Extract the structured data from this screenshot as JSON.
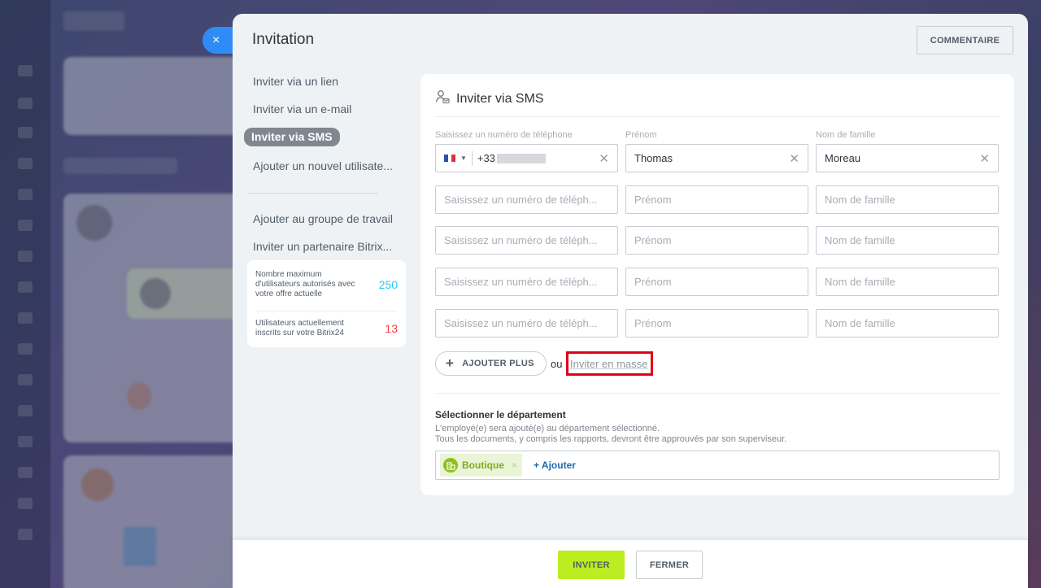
{
  "header": {
    "close_icon": "×",
    "title": "Invitation",
    "comment_button": "COMMENTAIRE"
  },
  "nav": {
    "items": [
      {
        "label": "Inviter via un lien",
        "active": false
      },
      {
        "label": "Inviter via un e-mail",
        "active": false
      },
      {
        "label": "Inviter via SMS",
        "active": true
      },
      {
        "label": "Ajouter un nouvel utilisate...",
        "active": false
      },
      {
        "label": "Ajouter au groupe de travail",
        "active": false
      },
      {
        "label": "Inviter un partenaire Bitrix...",
        "active": false
      }
    ]
  },
  "stats": {
    "max_users_label": "Nombre maximum d'utilisateurs autorisés avec votre offre actuelle",
    "max_users_value": "250",
    "max_users_color": "#2fc6f6",
    "current_users_label": "Utilisateurs actuellement inscrits sur votre Bitrix24",
    "current_users_value": "13",
    "current_users_color": "#f4433e"
  },
  "form": {
    "section_icon": "user-sms-icon",
    "section_title": "Inviter via SMS",
    "labels": {
      "phone": "Saisissez un numéro de téléphone",
      "first_name": "Prénom",
      "last_name": "Nom de famille"
    },
    "rows": [
      {
        "phone_prefix": "+33",
        "country_flag": "france-flag-icon",
        "phone_placeholder": "",
        "first_name": "Thomas",
        "last_name": "Moreau"
      },
      {
        "phone_placeholder": "Saisissez un numéro de téléph...",
        "first_name_placeholder": "Prénom",
        "last_name_placeholder": "Nom de famille"
      },
      {
        "phone_placeholder": "Saisissez un numéro de téléph...",
        "first_name_placeholder": "Prénom",
        "last_name_placeholder": "Nom de famille"
      },
      {
        "phone_placeholder": "Saisissez un numéro de téléph...",
        "first_name_placeholder": "Prénom",
        "last_name_placeholder": "Nom de famille"
      },
      {
        "phone_placeholder": "Saisissez un numéro de téléph...",
        "first_name_placeholder": "Prénom",
        "last_name_placeholder": "Nom de famille"
      }
    ],
    "add_more_label": "AJOUTER PLUS",
    "or_text": "ou",
    "mass_invite_label": "Inviter en masse"
  },
  "department": {
    "title": "Sélectionner le département",
    "desc_line1": "L'employé(e) sera ajouté(e) au département sélectionné.",
    "desc_line2": "Tous les documents, y compris les rapports, devront être approuvés par son superviseur.",
    "selected_tag": "Boutique",
    "tag_remove": "×",
    "add_link": "+ Ajouter"
  },
  "footer": {
    "invite_button": "INVITER",
    "close_button": "FERMER"
  }
}
